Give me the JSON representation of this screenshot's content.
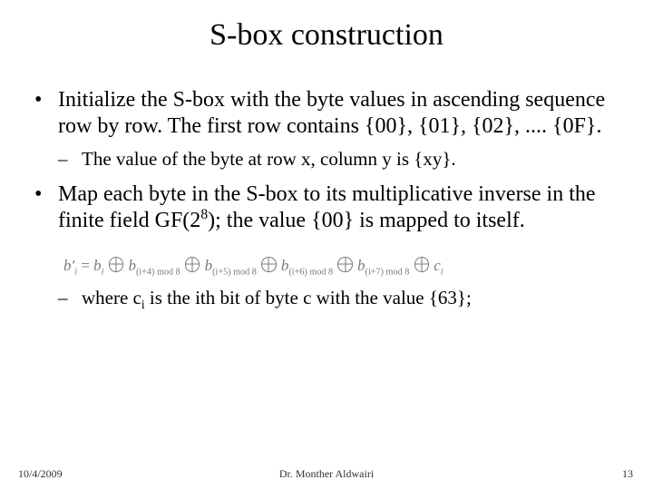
{
  "title": "S-box construction",
  "bullets": {
    "b1": "Initialize the S-box with the byte values in ascending sequence row by row. The first row contains {00}, {01}, {02}, .... {0F}.",
    "b1_sub": "The value of the byte at row x, column y is {xy}.",
    "b2_pre": "Map each byte in the S-box to its multiplicative inverse in the finite field GF(2",
    "b2_sup": "8",
    "b2_post": "); the value {00} is mapped to itself.",
    "b2_sub_pre": "where c",
    "b2_sub_sub": "i",
    "b2_sub_post": " is the ith bit of byte c with the value {63};"
  },
  "formula": {
    "lhs_var": "b",
    "lhs_prime": "′",
    "lhs_sub": "i",
    "eq": " = ",
    "t1_var": "b",
    "t1_sub": "i",
    "t2_var": "b",
    "t2_sub": "(i+4) mod 8",
    "t3_var": "b",
    "t3_sub": "(i+5) mod 8",
    "t4_var": "b",
    "t4_sub": "(i+6) mod 8",
    "t5_var": "b",
    "t5_sub": "(i+7) mod 8",
    "t6_var": "c",
    "t6_sub": "i"
  },
  "footer": {
    "date": "10/4/2009",
    "author": "Dr. Monther Aldwairi",
    "page": "13"
  }
}
